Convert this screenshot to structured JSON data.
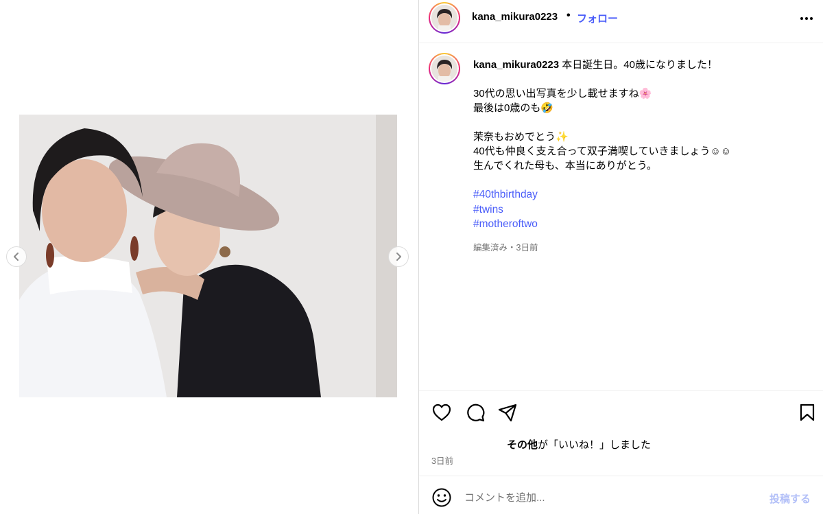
{
  "post": {
    "username": "kana_mikura0223",
    "separator": "•",
    "follow_label": "フォロー",
    "more_icon": "more-horizontal-icon"
  },
  "caption": {
    "username": "kana_mikura0223",
    "lines": [
      " 本日誕生日。40歳になりました！",
      "",
      "30代の思い出写真を少し載せますね🌸",
      "最後は0歳のも🤣",
      "",
      "茉奈もおめでとう✨",
      "40代も仲良く支え合って双子満喫していきましょう☺︎☺︎",
      "生んでくれた母も、本当にありがとう。",
      ""
    ],
    "hashtags": [
      "#40thbirthday",
      "#twins",
      "#motheroftwo"
    ],
    "meta": "編集済み・3日前"
  },
  "actions": {
    "like_icon": "heart-icon",
    "comment_icon": "comment-icon",
    "share_icon": "send-icon",
    "save_icon": "bookmark-icon",
    "likes_bold": "その他",
    "likes_rest": "が「いいね！」しました",
    "date": "3日前"
  },
  "comment": {
    "placeholder": "コメントを追加...",
    "post_label": "投稿する",
    "emoji_icon": "smiley-icon"
  },
  "carousel": {
    "prev_icon": "chevron-left-icon",
    "next_icon": "chevron-right-icon"
  },
  "colors": {
    "link": "#4a5df9",
    "muted": "#737373",
    "post_disabled": "#b3c0f8",
    "border": "#dbdbdb"
  }
}
